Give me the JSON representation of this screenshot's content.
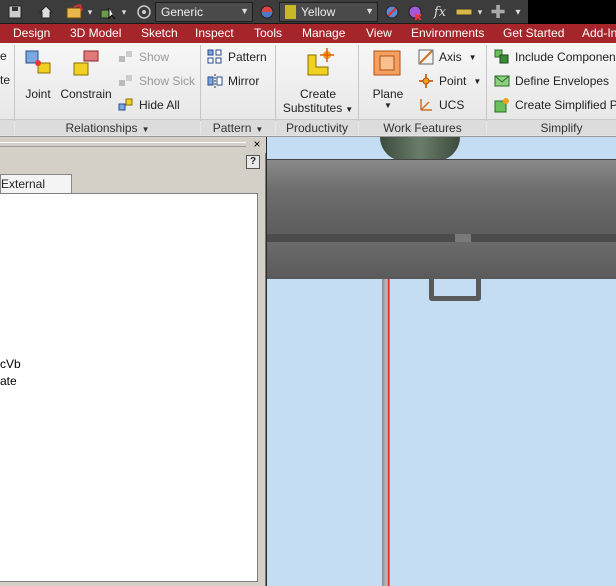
{
  "quick_access": {
    "material_value": "Generic",
    "appearance_value": "Yellow",
    "fx_label": "fx"
  },
  "tabs": [
    "Design",
    "3D Model",
    "Sketch",
    "Inspect",
    "Tools",
    "Manage",
    "View",
    "Environments",
    "Get Started",
    "Add-Ins"
  ],
  "ribbon": {
    "left_clipped": [
      "e",
      "te"
    ],
    "relationships": {
      "joint": "Joint",
      "constrain": "Constrain",
      "show": "Show",
      "show_sick": "Show Sick",
      "hide_all": "Hide All",
      "label": "Relationships"
    },
    "pattern": {
      "pattern": "Pattern",
      "mirror": "Mirror",
      "label": "Pattern"
    },
    "productivity": {
      "create_line1": "Create",
      "create_line2": "Substitutes",
      "label": "Productivity"
    },
    "work_features": {
      "plane": "Plane",
      "axis": "Axis",
      "point": "Point",
      "ucs": "UCS",
      "label": "Work Features"
    },
    "simplify": {
      "include": "Include Components",
      "define": "Define Envelopes",
      "create_simplified": "Create Simplified Part",
      "label": "Simplify"
    }
  },
  "browser": {
    "help": "?",
    "close": "×",
    "tab_external_rules": "External Rules",
    "items": [
      "cVb",
      "ate"
    ]
  },
  "colors": {
    "tab_bar": "#a6252a",
    "viewport_bg": "#c5ddf2"
  }
}
